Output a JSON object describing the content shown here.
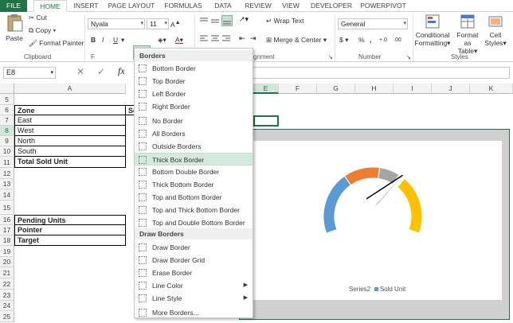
{
  "tabs": [
    "FILE",
    "HOME",
    "INSERT",
    "PAGE LAYOUT",
    "FORMULAS",
    "DATA",
    "REVIEW",
    "VIEW",
    "DEVELOPER",
    "POWERPIVOT"
  ],
  "ribbon": {
    "paste": "Paste",
    "cut": "Cut",
    "copy": "Copy",
    "format_painter": "Format Painter",
    "clipboard": "Clipboard",
    "font_name": "Nyala",
    "font_size": "11",
    "bold": "B",
    "italic": "I",
    "underline": "U",
    "font_color": "A",
    "font_group_letter": "F",
    "wrap_text": "Wrap Text",
    "merge_center": "Merge & Center",
    "alignment_tail": "gnment",
    "number_format": "General",
    "currency": "$",
    "percent": "%",
    "comma": ",",
    "number": "Number",
    "conditional_formatting": [
      "Conditional",
      "Formatting"
    ],
    "format_as_table": [
      "Format as",
      "Table"
    ],
    "cell_styles": [
      "Cell",
      "Styles"
    ],
    "styles": "Styles"
  },
  "formula_bar": {
    "name_box": "E8",
    "fx": "fx"
  },
  "columns": [
    "A",
    "E",
    "F",
    "G",
    "H",
    "I",
    "J",
    "K"
  ],
  "rows": [
    "5",
    "6",
    "7",
    "8",
    "9",
    "10",
    "11",
    "12",
    "13",
    "14",
    "15",
    "16",
    "17",
    "18",
    "19",
    "20",
    "21",
    "22",
    "23",
    "24",
    "25"
  ],
  "cells": {
    "zone": "Zone",
    "so": "So",
    "east": "East",
    "west": "West",
    "north": "North",
    "south": "South",
    "total": "Total Sold Unit",
    "pending": "Pending Units",
    "pointer": "Pointer",
    "target": "Target"
  },
  "menu": {
    "borders_header": "Borders",
    "items_top": [
      "Bottom Border",
      "Top Border",
      "Left Border",
      "Right Border",
      "No Border",
      "All Borders",
      "Outside Borders",
      "Thick Box Border",
      "Bottom Double Border",
      "Thick Bottom Border",
      "Top and Bottom Border",
      "Top and Thick Bottom Border",
      "Top and Double Bottom Border"
    ],
    "draw_header": "Draw Borders",
    "items_draw": [
      "Draw Border",
      "Draw Border Grid",
      "Erase Border",
      "Line Color",
      "Line Style",
      "More Borders..."
    ]
  },
  "chart_data": {
    "type": "pie",
    "subtype": "gauge-doughnut",
    "legend": [
      "Series2",
      "Sold Unit"
    ],
    "legend_colors": [
      "#ffffff",
      "#5b9bd5"
    ],
    "segment_colors": [
      "#5b9bd5",
      "#ed7d31",
      "#a5a5a5",
      "#ffc000"
    ],
    "needle_color": "#000000"
  }
}
